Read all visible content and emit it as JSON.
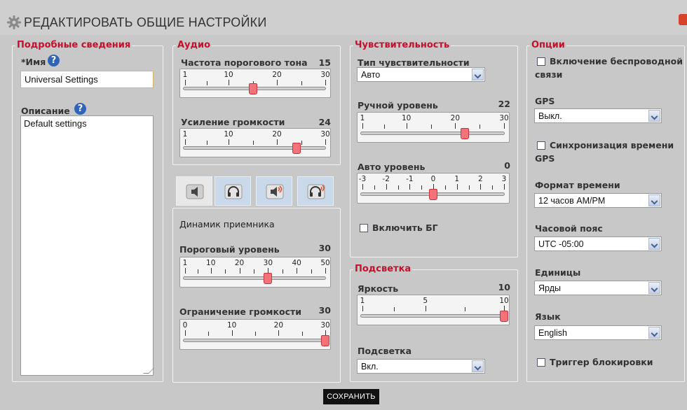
{
  "window": {
    "title": "РЕДАКТИРОВАТЬ ОБЩИЕ НАСТРОЙКИ"
  },
  "details": {
    "legend": "Подробные сведения",
    "name_label": "*Имя",
    "name_value": "Universal Settings",
    "desc_label": "Описание",
    "desc_value": "Default settings"
  },
  "audio": {
    "legend": "Аудио",
    "threshold_tone": {
      "label": "Частота порогового тона",
      "value": "15",
      "level": 15,
      "min": 1,
      "max": 30,
      "ticks": [
        "1",
        "10",
        "20",
        "30"
      ]
    },
    "volume_gain": {
      "label": "Усиление громкости",
      "value": "24",
      "level": 24,
      "min": 1,
      "max": 30,
      "ticks": [
        "1",
        "10",
        "20",
        "30"
      ]
    },
    "receiver_label": "Динамик приемника",
    "threshold_level": {
      "label": "Пороговый уровень",
      "value": "30",
      "level": 30,
      "min": 1,
      "max": 50,
      "ticks": [
        "1",
        "10",
        "20",
        "30",
        "40",
        "50"
      ]
    },
    "volume_limit": {
      "label": "Ограничение громкости",
      "value": "30",
      "level": 30,
      "min": 0,
      "max": 30,
      "ticks": [
        "0",
        "10",
        "20",
        "30"
      ]
    },
    "tabs": [
      {
        "icon": "speaker-icon",
        "active": true
      },
      {
        "icon": "headphones-icon",
        "active": false
      },
      {
        "icon": "speaker-wireless-icon",
        "active": false
      },
      {
        "icon": "headphones-wireless-icon",
        "active": false
      }
    ]
  },
  "sensitivity": {
    "legend": "Чувствительность",
    "type_label": "Тип чувствительности",
    "type_value": "Авто",
    "manual": {
      "label": "Ручной уровень",
      "value": "22",
      "level": 22,
      "min": 1,
      "max": 30,
      "ticks": [
        "1",
        "10",
        "20",
        "30"
      ]
    },
    "auto": {
      "label": "Авто уровень",
      "value": "0",
      "level": 0,
      "min": -3,
      "max": 3,
      "ticks": [
        "-3",
        "-2",
        "-1",
        "0",
        "1",
        "2",
        "3"
      ]
    },
    "bg_label": "Включить БГ"
  },
  "backlight": {
    "legend": "Подсветка",
    "brightness": {
      "label": "Яркость",
      "value": "10",
      "level": 10,
      "min": 1,
      "max": 10,
      "ticks": [
        "1",
        "5",
        "10"
      ]
    },
    "backlight_label": "Подсветка",
    "backlight_value": "Вкл."
  },
  "options": {
    "legend": "Опции",
    "wireless_label": "Включение беспроводной",
    "wireless_label2": "связи",
    "gps_label": "GPS",
    "gps_value": "Выкл.",
    "gps_sync_label": "Синхронизация времени",
    "gps_sync_label2": "GPS",
    "time_format_label": "Формат времени",
    "time_format_value": "12 часов AM/PM",
    "timezone_label": "Часовой пояс",
    "timezone_value": "UTC -05:00",
    "units_label": "Единицы",
    "units_value": "Ярды",
    "language_label": "Язык",
    "language_value": "English",
    "lock_trigger_label": "Триггер блокировки"
  },
  "footer": {
    "save_label": "СОХРАНИТЬ"
  },
  "colors": {
    "legend": "#c6102b",
    "thumb": "#f4737b",
    "help": "#2f64b7",
    "tab_bg": "#c9d9ea"
  }
}
